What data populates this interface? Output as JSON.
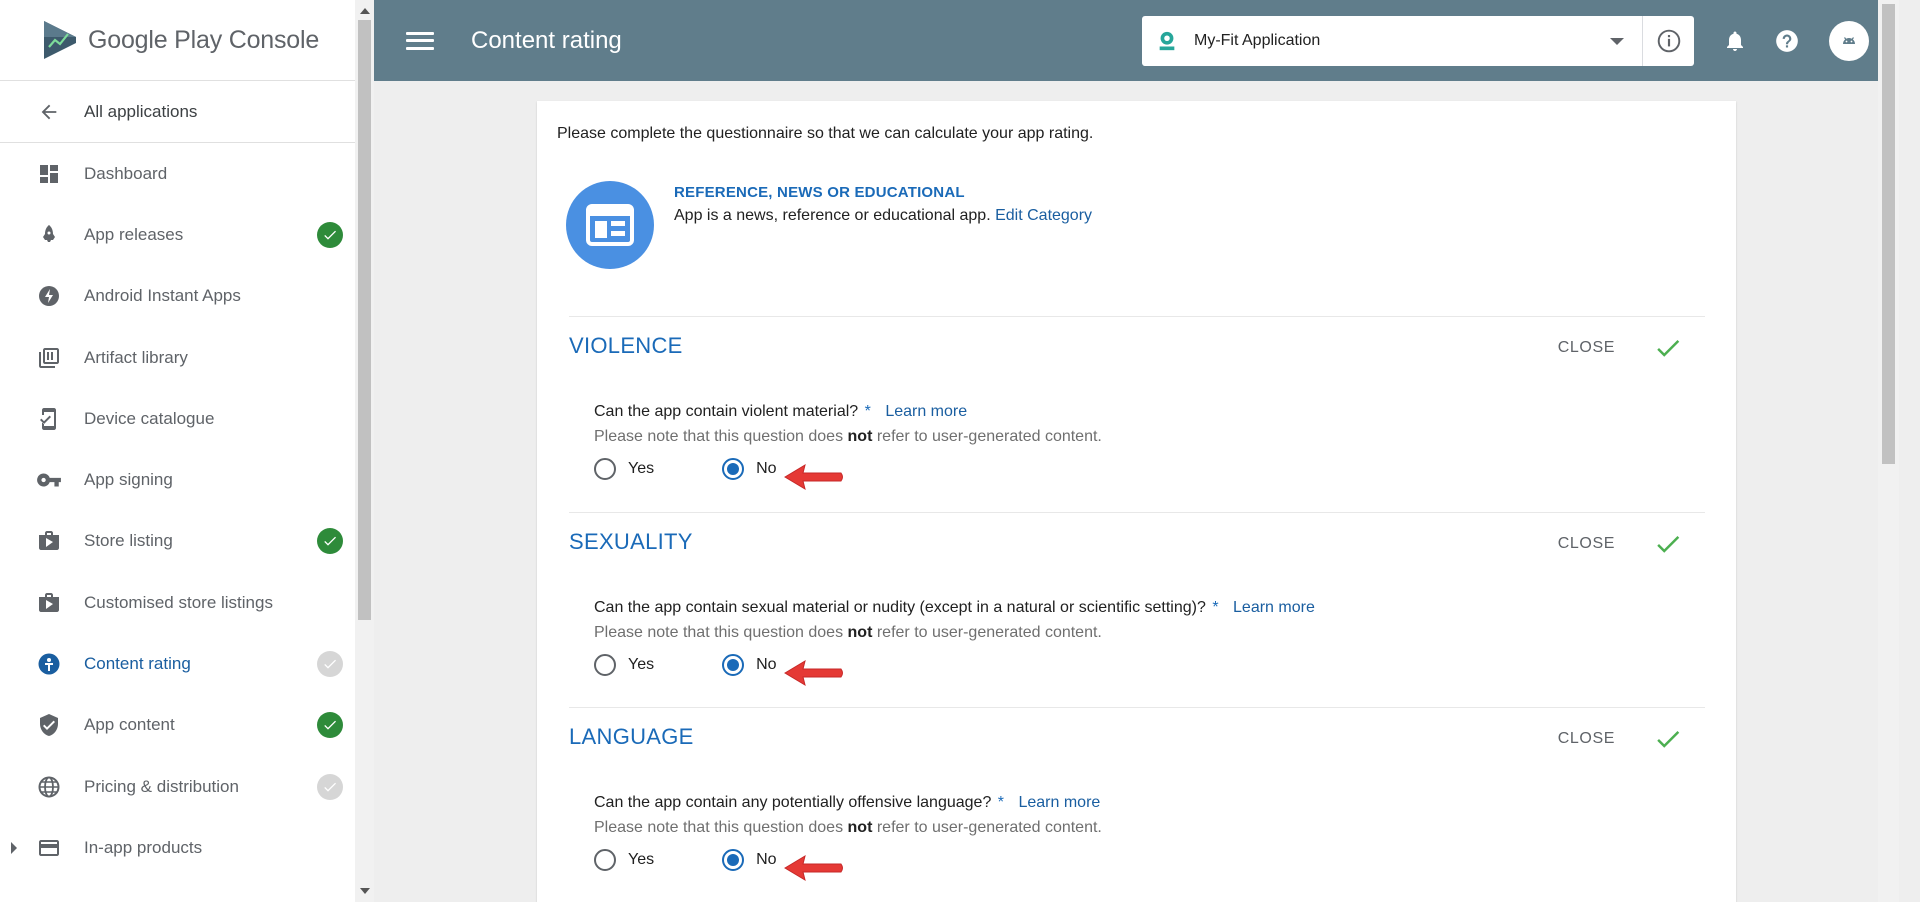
{
  "sidebar": {
    "logo_text": "Google Play Console",
    "back_label": "All applications",
    "items": [
      {
        "label": "Dashboard",
        "status": "none"
      },
      {
        "label": "App releases",
        "status": "done"
      },
      {
        "label": "Android Instant Apps",
        "status": "none"
      },
      {
        "label": "Artifact library",
        "status": "none"
      },
      {
        "label": "Device catalogue",
        "status": "none"
      },
      {
        "label": "App signing",
        "status": "none"
      },
      {
        "label": "Store listing",
        "status": "done"
      },
      {
        "label": "Customised store listings",
        "status": "none"
      },
      {
        "label": "Content rating",
        "status": "pending",
        "active": true
      },
      {
        "label": "App content",
        "status": "done"
      },
      {
        "label": "Pricing & distribution",
        "status": "pending"
      },
      {
        "label": "In-app products",
        "status": "none"
      }
    ]
  },
  "header": {
    "title": "Content rating",
    "app_name": "My-Fit Application"
  },
  "content": {
    "intro": "Please complete the questionnaire so that we can calculate your app rating.",
    "category": {
      "title": "REFERENCE, NEWS OR EDUCATIONAL",
      "description": "App is a news, reference or educational app.",
      "edit_link": "Edit Category"
    },
    "common": {
      "close_label": "CLOSE",
      "learn_more": "Learn more",
      "required_mark": "*",
      "note_prefix": "Please note that this question does",
      "note_bold": "not",
      "note_suffix": "refer to user-generated content.",
      "yes": "Yes",
      "no": "No"
    },
    "sections": [
      {
        "title": "VIOLENCE",
        "question": "Can the app contain violent material?",
        "answer": "No"
      },
      {
        "title": "SEXUALITY",
        "question": "Can the app contain sexual material or nudity (except in a natural or scientific setting)?",
        "answer": "No"
      },
      {
        "title": "LANGUAGE",
        "question": "Can the app contain any potentially offensive language?",
        "answer": "No"
      }
    ]
  },
  "colors": {
    "topbar": "#607d8b",
    "accent": "#1a6ab8",
    "done": "#2e8b3a",
    "pending": "#d6d6d6",
    "check": "#4caf50",
    "arrow": "#e53935"
  }
}
